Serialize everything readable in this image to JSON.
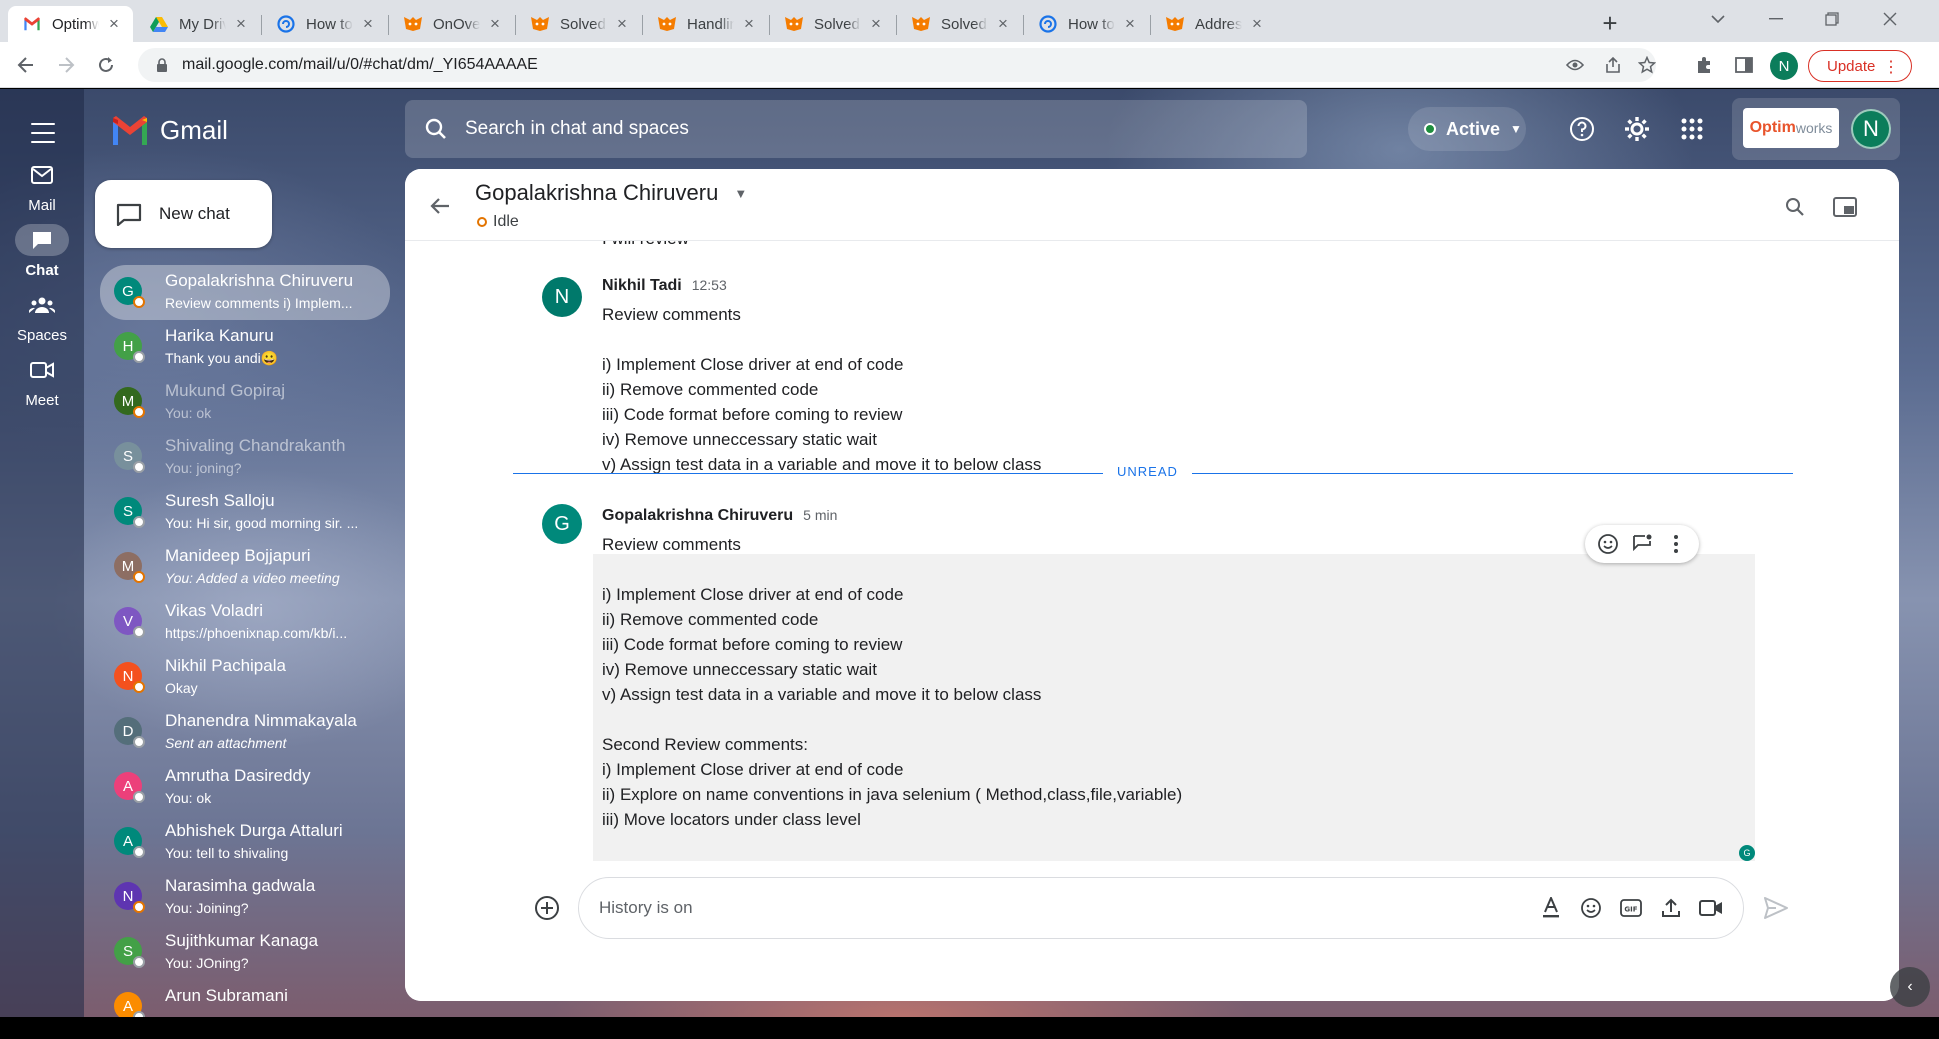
{
  "browser": {
    "tabs": [
      {
        "title": "Optimworks",
        "icon": "gmail-icon",
        "active": true
      },
      {
        "title": "My Drive - Google",
        "icon": "drive-icon"
      },
      {
        "title": "How to add",
        "icon": "help-circle-icon"
      },
      {
        "title": "OnOverlapping",
        "icon": "community-icon"
      },
      {
        "title": "Solved: How",
        "icon": "community-icon"
      },
      {
        "title": "Handling Unsaved",
        "icon": "community-icon"
      },
      {
        "title": "Solved: Test",
        "icon": "community-icon"
      },
      {
        "title": "Solved: Re:",
        "icon": "community-icon"
      },
      {
        "title": "How to add",
        "icon": "help-circle-icon"
      },
      {
        "title": "Addressing",
        "icon": "community-icon"
      }
    ],
    "url": "mail.google.com/mail/u/0/#chat/dm/_YI654AAAAE",
    "profile_initial": "N",
    "update_label": "Update"
  },
  "app": {
    "product": "Gmail",
    "rail": [
      {
        "label": "Mail",
        "icon": "mail-icon"
      },
      {
        "label": "Chat",
        "icon": "chat-icon",
        "active": true
      },
      {
        "label": "Spaces",
        "icon": "spaces-icon"
      },
      {
        "label": "Meet",
        "icon": "video-icon"
      }
    ],
    "new_chat_label": "New chat",
    "search_placeholder": "Search in chat and spaces",
    "status_label": "Active",
    "org_logo": {
      "part1": "Optim",
      "part2": "works"
    },
    "account_initial": "N"
  },
  "chats": [
    {
      "initial": "G",
      "name": "Gopalakrishna Chiruveru",
      "snippet": "Review comments i) Implem...",
      "color": "#00897b",
      "status": "idle",
      "selected": true
    },
    {
      "initial": "H",
      "name": "Harika Kanuru",
      "snippet": "Thank you andi😀",
      "color": "#43a047",
      "status": "off"
    },
    {
      "initial": "M",
      "name": "Mukund Gopiraj",
      "snippet": "You: ok",
      "color": "#33691e",
      "status": "idle",
      "dim": true
    },
    {
      "initial": "S",
      "name": "Shivaling Chandrakanth",
      "snippet": "You: joning?",
      "color": "#78909c",
      "status": "off",
      "dim": true
    },
    {
      "initial": "S",
      "name": "Suresh Salloju",
      "snippet": "You: Hi sir, good morning sir. ...",
      "color": "#00897b",
      "status": "off"
    },
    {
      "initial": "M",
      "name": "Manideep Bojjapuri",
      "snippet": "You: Added a video meeting",
      "color": "#8d6e63",
      "status": "idle",
      "italic_snippet": true
    },
    {
      "initial": "V",
      "name": "Vikas Voladri",
      "snippet": "https://phoenixnap.com/kb/i...",
      "color": "#7e57c2",
      "status": "off"
    },
    {
      "initial": "N",
      "name": "Nikhil Pachipala",
      "snippet": "Okay",
      "color": "#f4511e",
      "status": "idle"
    },
    {
      "initial": "D",
      "name": "Dhanendra Nimmakayala",
      "snippet": "Sent an attachment",
      "color": "#546e7a",
      "status": "off",
      "italic_snippet": true
    },
    {
      "initial": "A",
      "name": "Amrutha Dasireddy",
      "snippet": "You: ok",
      "color": "#ec407a",
      "status": "off"
    },
    {
      "initial": "A",
      "name": "Abhishek Durga Attaluri",
      "snippet": "You: tell to shivaling",
      "color": "#00897b",
      "status": "off"
    },
    {
      "initial": "N",
      "name": "Narasimha gadwala",
      "snippet": "You: Joining?",
      "color": "#5e35b1",
      "status": "idle"
    },
    {
      "initial": "S",
      "name": "Sujithkumar Kanaga",
      "snippet": "You: JOning?",
      "color": "#43a047",
      "status": "off"
    },
    {
      "initial": "A",
      "name": "Arun Subramani",
      "snippet": "",
      "color": "#fb8c00",
      "status": "off"
    }
  ],
  "conversation": {
    "title": "Gopalakrishna Chiruveru",
    "presence": "Idle",
    "partial_previous": "I will review",
    "messages": [
      {
        "initial": "N",
        "avatar_color": "#00796b",
        "sender": "Nikhil Tadi",
        "time": "12:53",
        "lines": [
          "Review comments",
          "",
          "i) Implement Close driver at end of code",
          "ii) Remove commented code",
          "iii) Code format before coming to review",
          "iv) Remove unneccessary static wait",
          "v) Assign test data in a variable and move it to below class"
        ]
      },
      {
        "initial": "G",
        "avatar_color": "#00897b",
        "sender": "Gopalakrishna Chiruveru",
        "time": "5 min",
        "lines": [
          "Review comments",
          "",
          "i) Implement Close driver at end of code",
          "ii) Remove commented code",
          "iii) Code format before coming to review",
          "iv) Remove unneccessary static wait",
          "v) Assign test data in a variable and move it to below class",
          "",
          "Second Review comments:",
          "i) Implement Close driver at end of code",
          "ii) Explore on name conventions in java selenium ( Method,class,file,variable)",
          "iii) Move locators under class level"
        ]
      }
    ],
    "unread_label": "UNREAD",
    "read_receipt_initial": "G",
    "composer_placeholder": "History is on"
  }
}
